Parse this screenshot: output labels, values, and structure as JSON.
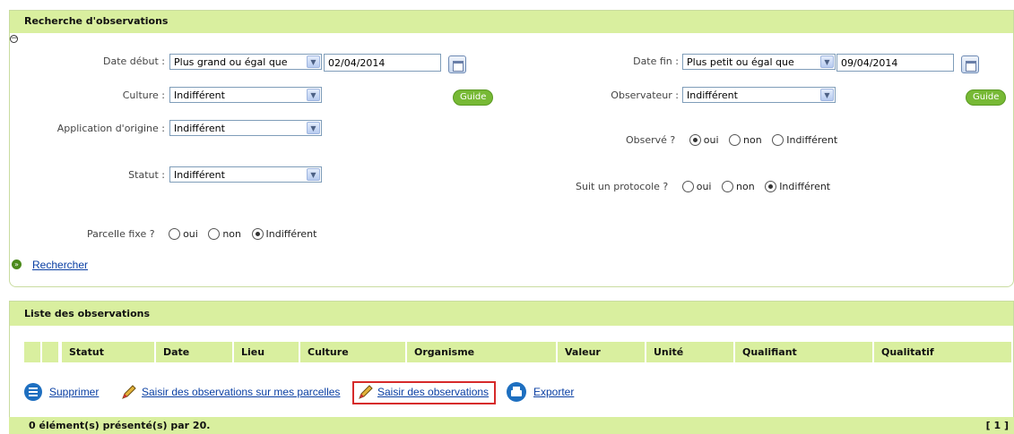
{
  "search": {
    "title": "Recherche d'observations",
    "collapse_icon": "minus-box-icon",
    "date_debut": {
      "label": "Date début :",
      "operator": "Plus grand ou égal que",
      "value": "02/04/2014"
    },
    "date_fin": {
      "label": "Date fin :",
      "operator": "Plus petit ou égal que",
      "value": "09/04/2014"
    },
    "culture": {
      "label": "Culture :",
      "value": "Indifférent"
    },
    "observateur": {
      "label": "Observateur :",
      "value": "Indifférent"
    },
    "application": {
      "label": "Application d'origine :",
      "value": "Indifférent"
    },
    "statut": {
      "label": "Statut :",
      "value": "Indifférent"
    },
    "guide_label": "Guide",
    "observe": {
      "label": "Observé ?",
      "options": [
        "oui",
        "non",
        "Indifférent"
      ],
      "selected": "oui"
    },
    "protocole": {
      "label": "Suit un protocole ?",
      "options": [
        "oui",
        "non",
        "Indifférent"
      ],
      "selected": "Indifférent"
    },
    "parcelle": {
      "label": "Parcelle fixe ?",
      "options": [
        "oui",
        "non",
        "Indifférent"
      ],
      "selected": "Indifférent"
    },
    "search_link": "Rechercher"
  },
  "list": {
    "title": "Liste des observations",
    "columns": [
      "Statut",
      "Date",
      "Lieu",
      "Culture",
      "Organisme",
      "Valeur",
      "Unité",
      "Qualifiant",
      "Qualitatif"
    ],
    "actions": {
      "delete": "Supprimer",
      "enter_my_plots": "Saisir des observations sur mes parcelles",
      "enter": "Saisir des observations",
      "export": "Exporter"
    },
    "footer_count": "0 élément(s) présenté(s) par 20.",
    "pagination": "[ 1 ]"
  },
  "colors": {
    "header_green": "#d9ef9f",
    "guide_green": "#77b935",
    "highlight_red": "#d62a2a",
    "link_blue": "#0a3fa3"
  }
}
